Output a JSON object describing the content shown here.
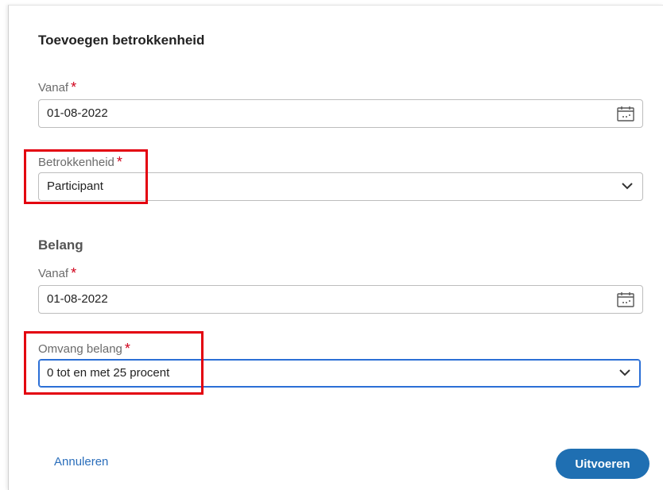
{
  "dialog": {
    "title": "Toevoegen betrokkenheid",
    "required_marker": "*",
    "fields": {
      "vanaf": {
        "label": "Vanaf",
        "value": "01-08-2022",
        "icon": "calendar-icon"
      },
      "betrokkenheid": {
        "label": "Betrokkenheid",
        "value": "Participant",
        "icon": "chevron-down-icon"
      }
    },
    "belang": {
      "heading": "Belang",
      "vanaf": {
        "label": "Vanaf",
        "value": "01-08-2022",
        "icon": "calendar-icon"
      },
      "omvang": {
        "label": "Omvang belang",
        "value": "0 tot en met 25 procent",
        "icon": "chevron-down-icon"
      }
    },
    "actions": {
      "cancel_label": "Annuleren",
      "submit_label": "Uitvoeren"
    }
  },
  "colors": {
    "required": "#d0021b",
    "highlight": "#e3000f",
    "primary_button": "#1f6fb2",
    "link": "#2a6ebb",
    "focus": "#2b6fd6"
  }
}
